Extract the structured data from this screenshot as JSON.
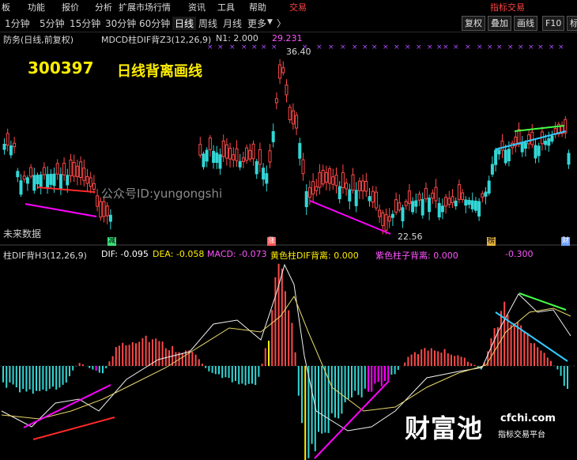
{
  "topbar": {
    "left_fragments": [
      "板",
      "功能",
      "报价",
      "分析",
      "扩展市场行情",
      "资讯",
      "工具",
      "帮助"
    ],
    "right_fragments": [
      "交易",
      "指标交易"
    ]
  },
  "toolbar": {
    "timeframes": [
      "1分钟",
      "5分钟",
      "15分钟",
      "30分钟",
      "60分钟",
      "日线",
      "周线",
      "月线",
      "更多"
    ],
    "active": "日线",
    "more_arrow": "▼",
    "nav_arrow": "〉",
    "right_buttons": [
      "复权",
      "叠加",
      "画线",
      "F10",
      "标记"
    ]
  },
  "price_panel": {
    "header": {
      "name": "防务(日线,前复权)",
      "indicator": "MDCD柱DIF背Z3(12,26,9)",
      "n1": "N1: 2.000",
      "value": "29.231"
    },
    "code": "300397",
    "title": "日线背离画线",
    "watermark": "公众号ID:yungongshi",
    "no_future": "未来数据",
    "high_label": "36.40",
    "low_label": "22.56",
    "tags": [
      {
        "text": "减",
        "color": "#3adf7a"
      },
      {
        "text": "涨",
        "color": "#ff5555"
      },
      {
        "text": "榜",
        "color": "#e0b040"
      },
      {
        "text": "财",
        "color": "#6fa0ff"
      }
    ]
  },
  "macd_panel": {
    "header": {
      "name": "柱DIF背H3(12,26,9)",
      "dif": "DIF: -0.095",
      "dea": "DEA: -0.058",
      "macd": "MACD: -0.073",
      "yellow": "黄色柱DIF背离: 0.000",
      "purple": "紫色柱子背离: 0.000",
      "last": "-0.300"
    }
  },
  "logo": {
    "brand": "财富池",
    "site": "cfchi.com",
    "tagline": "指标交易平台"
  },
  "colors": {
    "background": "#000000",
    "up": "#ff4a4a",
    "down": "#33d6d6",
    "magenta": "#ff00ff",
    "yellow": "#ffee00",
    "green": "#44ff44",
    "cyan": "#33ccff",
    "red_line": "#ff2a2a"
  }
}
